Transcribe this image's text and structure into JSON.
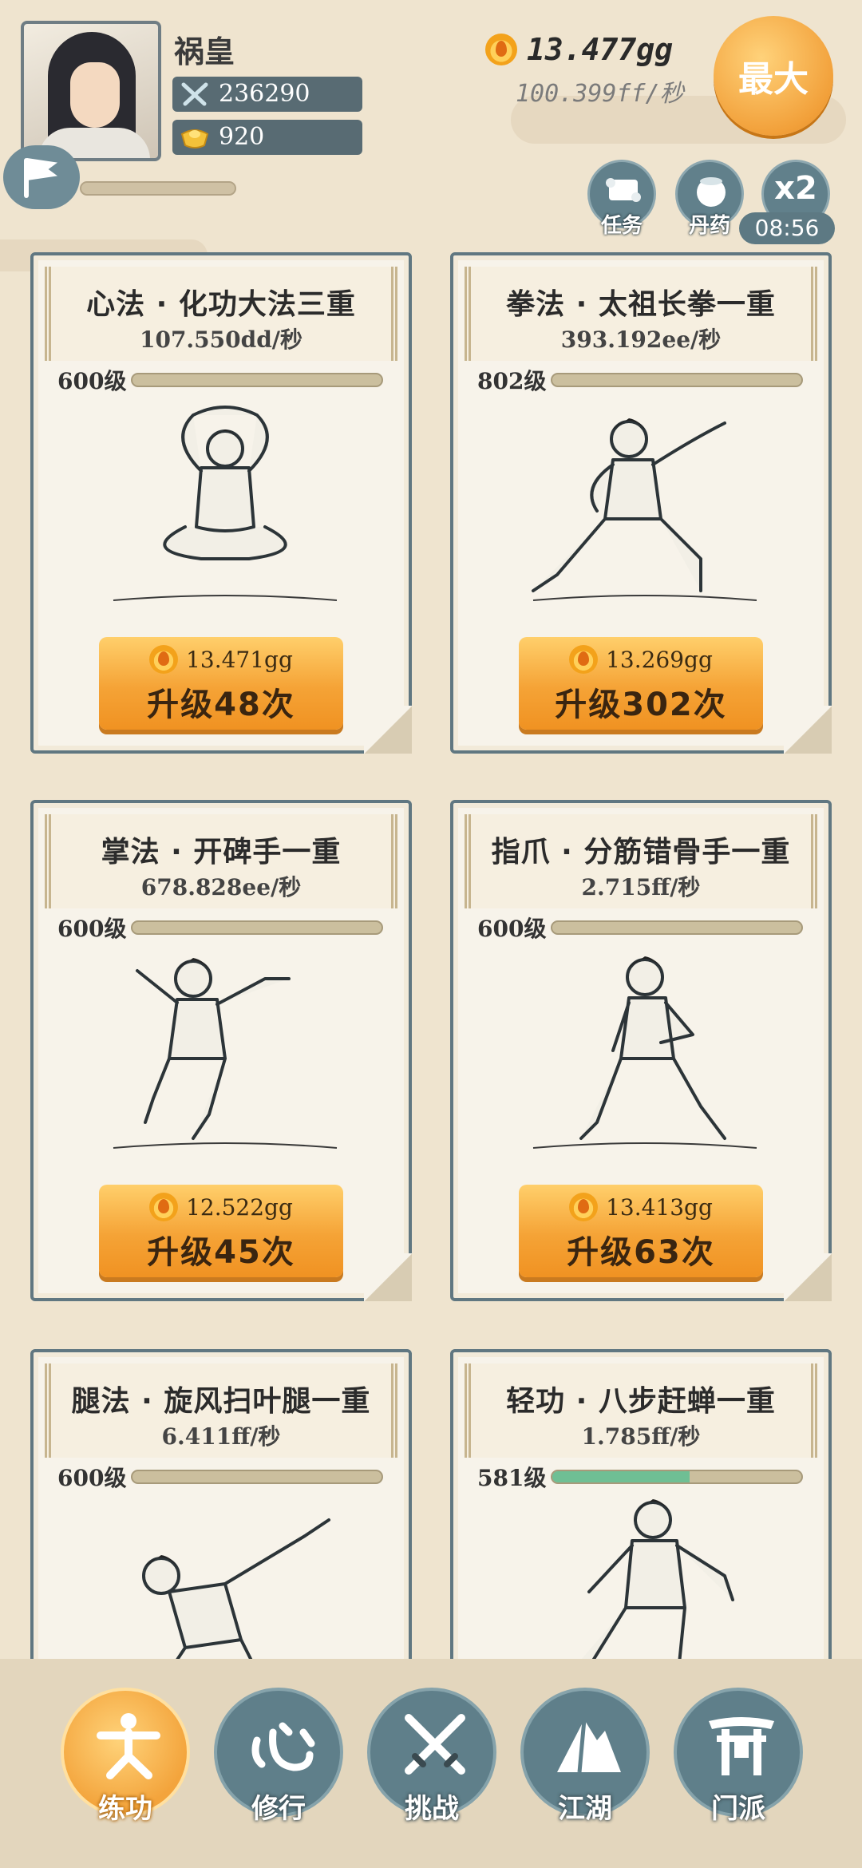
{
  "player": {
    "name": "祸皇",
    "power": "236290",
    "ingots": "920"
  },
  "currency": {
    "gold_total": "13.477gg",
    "gold_rate": "100.399ff/秒",
    "max_label": "最大"
  },
  "actions": {
    "task_label": "任务",
    "pill_label": "丹药",
    "boost_label": "x2",
    "boost_timer": "08:56"
  },
  "skills": [
    {
      "name": "心法 · 化功大法三重",
      "rate": "107.550dd/秒",
      "level": "600级",
      "progress": 0,
      "cost": "13.471gg",
      "upgrade": "升级48次"
    },
    {
      "name": "拳法 · 太祖长拳一重",
      "rate": "393.192ee/秒",
      "level": "802级",
      "progress": 0,
      "cost": "13.269gg",
      "upgrade": "升级302次"
    },
    {
      "name": "掌法 · 开碑手一重",
      "rate": "678.828ee/秒",
      "level": "600级",
      "progress": 0,
      "cost": "12.522gg",
      "upgrade": "升级45次"
    },
    {
      "name": "指爪 · 分筋错骨手一重",
      "rate": "2.715ff/秒",
      "level": "600级",
      "progress": 0,
      "cost": "13.413gg",
      "upgrade": "升级63次"
    },
    {
      "name": "腿法 · 旋风扫叶腿一重",
      "rate": "6.411ff/秒",
      "level": "600级",
      "progress": 0,
      "cost": "",
      "upgrade": ""
    },
    {
      "name": "轻功 · 八步赶蝉一重",
      "rate": "1.785ff/秒",
      "level": "581级",
      "progress": 0.55,
      "cost": "",
      "upgrade": ""
    }
  ],
  "nav": [
    {
      "label": "练功",
      "icon": "martial-figure-icon",
      "active": true
    },
    {
      "label": "修行",
      "icon": "heart-character-icon",
      "active": false
    },
    {
      "label": "挑战",
      "icon": "crossed-swords-icon",
      "active": false
    },
    {
      "label": "江湖",
      "icon": "mountain-icon",
      "active": false
    },
    {
      "label": "门派",
      "icon": "gate-icon",
      "active": false
    }
  ],
  "colors": {
    "accent_orange": "#f5a336",
    "slate_blue": "#607781",
    "paper": "#f7f3ea",
    "progress_green": "#6fbf94"
  }
}
